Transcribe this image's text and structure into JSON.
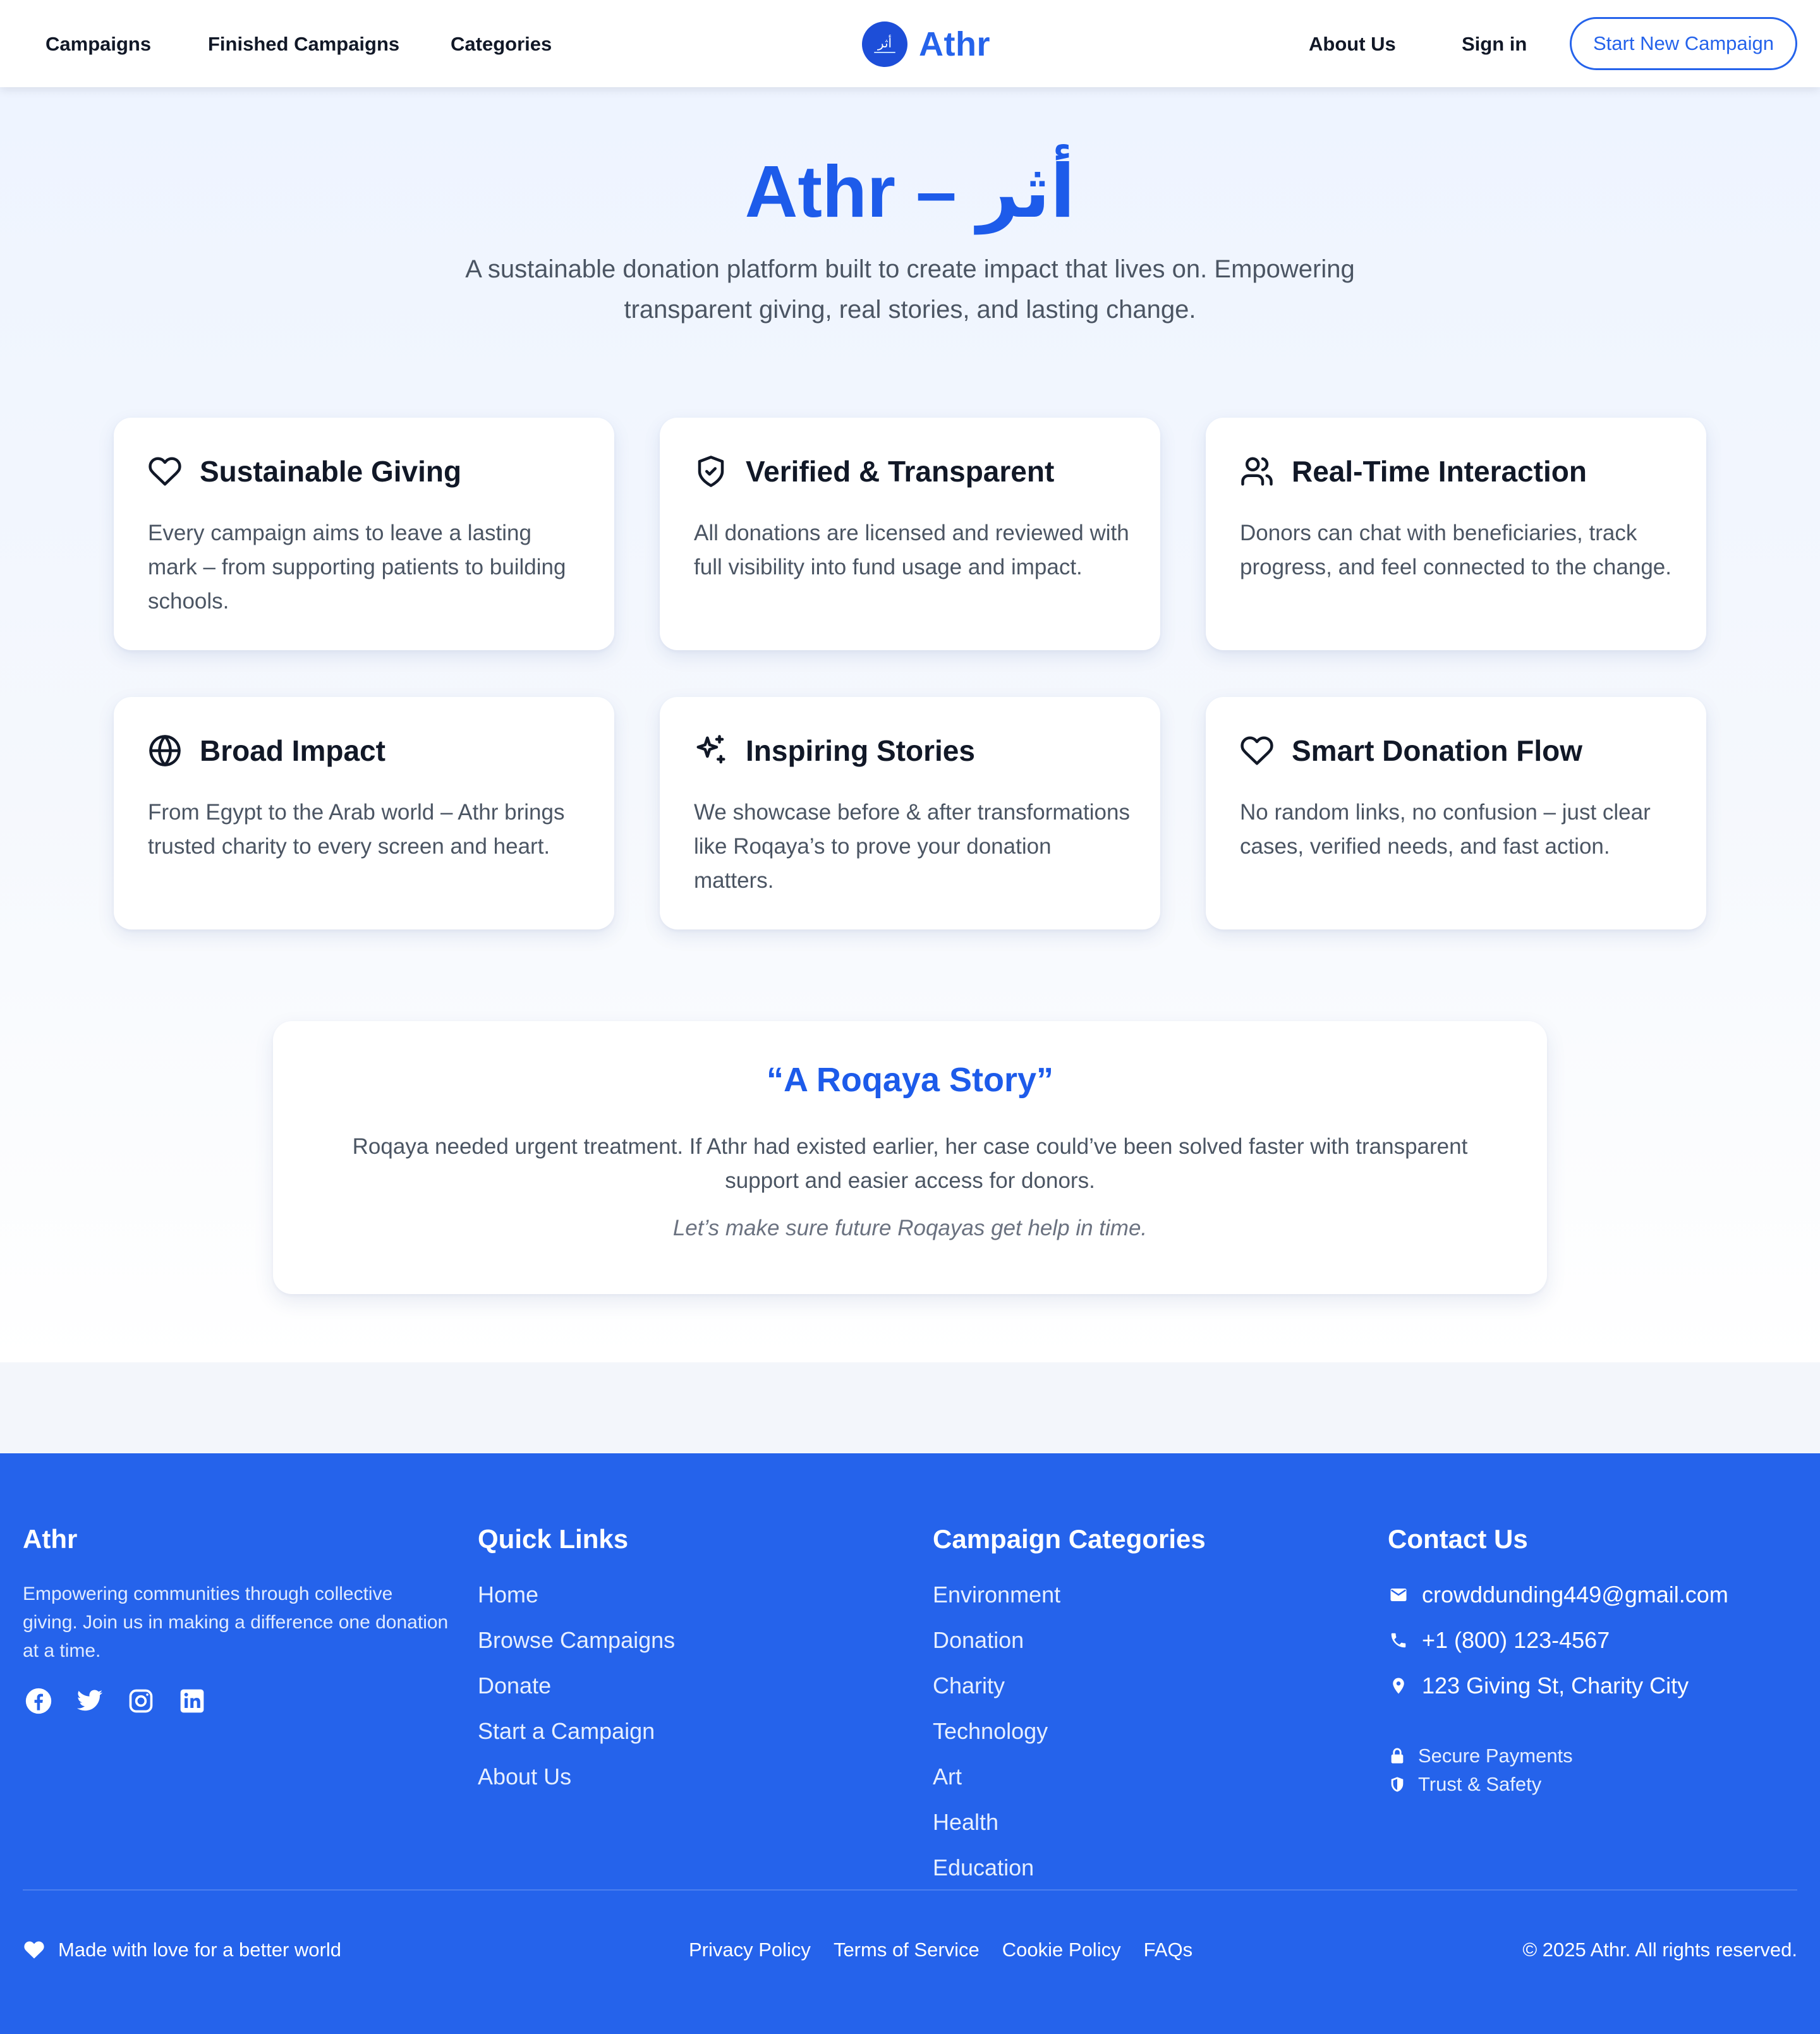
{
  "colors": {
    "accent": "#2563eb",
    "hero_blue": "#1d5bea",
    "footer_bg": "#2563eb",
    "text_muted": "#4b5563"
  },
  "nav": {
    "links": [
      "Campaigns",
      "Finished Campaigns",
      "Categories"
    ],
    "brand_name": "Athr",
    "logo_mark": "أثر",
    "about": "About Us",
    "signin": "Sign in",
    "cta": "Start New Campaign"
  },
  "hero": {
    "title_latin": "Athr – ",
    "title_arabic": "أثر",
    "subtitle": "A sustainable donation platform built to create impact that lives on. Empowering transparent giving, real stories, and lasting change."
  },
  "features": [
    {
      "icon": "heart-icon",
      "title": "Sustainable Giving",
      "text": "Every campaign aims to leave a lasting mark – from supporting patients to building schools."
    },
    {
      "icon": "shield-check-icon",
      "title": "Verified & Transparent",
      "text": "All donations are licensed and reviewed with full visibility into fund usage and impact."
    },
    {
      "icon": "users-icon",
      "title": "Real-Time Interaction",
      "text": "Donors can chat with beneficiaries, track progress, and feel connected to the change."
    },
    {
      "icon": "globe-icon",
      "title": "Broad Impact",
      "text": "From Egypt to the Arab world – Athr brings trusted charity to every screen and heart."
    },
    {
      "icon": "sparkles-icon",
      "title": "Inspiring Stories",
      "text": "We showcase before & after transformations like Roqaya’s to prove your donation matters."
    },
    {
      "icon": "heart-icon",
      "title": "Smart Donation Flow",
      "text": "No random links, no confusion – just clear cases, verified needs, and fast action."
    }
  ],
  "story": {
    "title": "“A Roqaya Story”",
    "text": "Roqaya needed urgent treatment. If Athr had existed earlier, her case could’ve been solved faster with transparent support and easier access for donors.",
    "quote": "Let’s make sure future Roqayas get help in time."
  },
  "footer": {
    "brand": "Athr",
    "about": "Empowering communities through collective giving. Join us in making a difference one donation at a time.",
    "social": [
      "facebook-icon",
      "twitter-icon",
      "instagram-icon",
      "linkedin-icon"
    ],
    "quick_links_heading": "Quick Links",
    "quick_links": [
      "Home",
      "Browse Campaigns",
      "Donate",
      "Start a Campaign",
      "About Us"
    ],
    "categories_heading": "Campaign Categories",
    "categories": [
      "Environment",
      "Donation",
      "Charity",
      "Technology",
      "Art",
      "Health",
      "Education"
    ],
    "contact_heading": "Contact Us",
    "email": "crowddunding449@gmail.com",
    "phone": "+1 (800) 123-4567",
    "address": "123 Giving St, Charity City",
    "trust": [
      "Secure Payments",
      "Trust & Safety"
    ],
    "made_with": "Made with love for a better world",
    "legal": [
      "Privacy Policy",
      "Terms of Service",
      "Cookie Policy",
      "FAQs"
    ],
    "copyright": "© 2025 Athr. All rights reserved."
  }
}
